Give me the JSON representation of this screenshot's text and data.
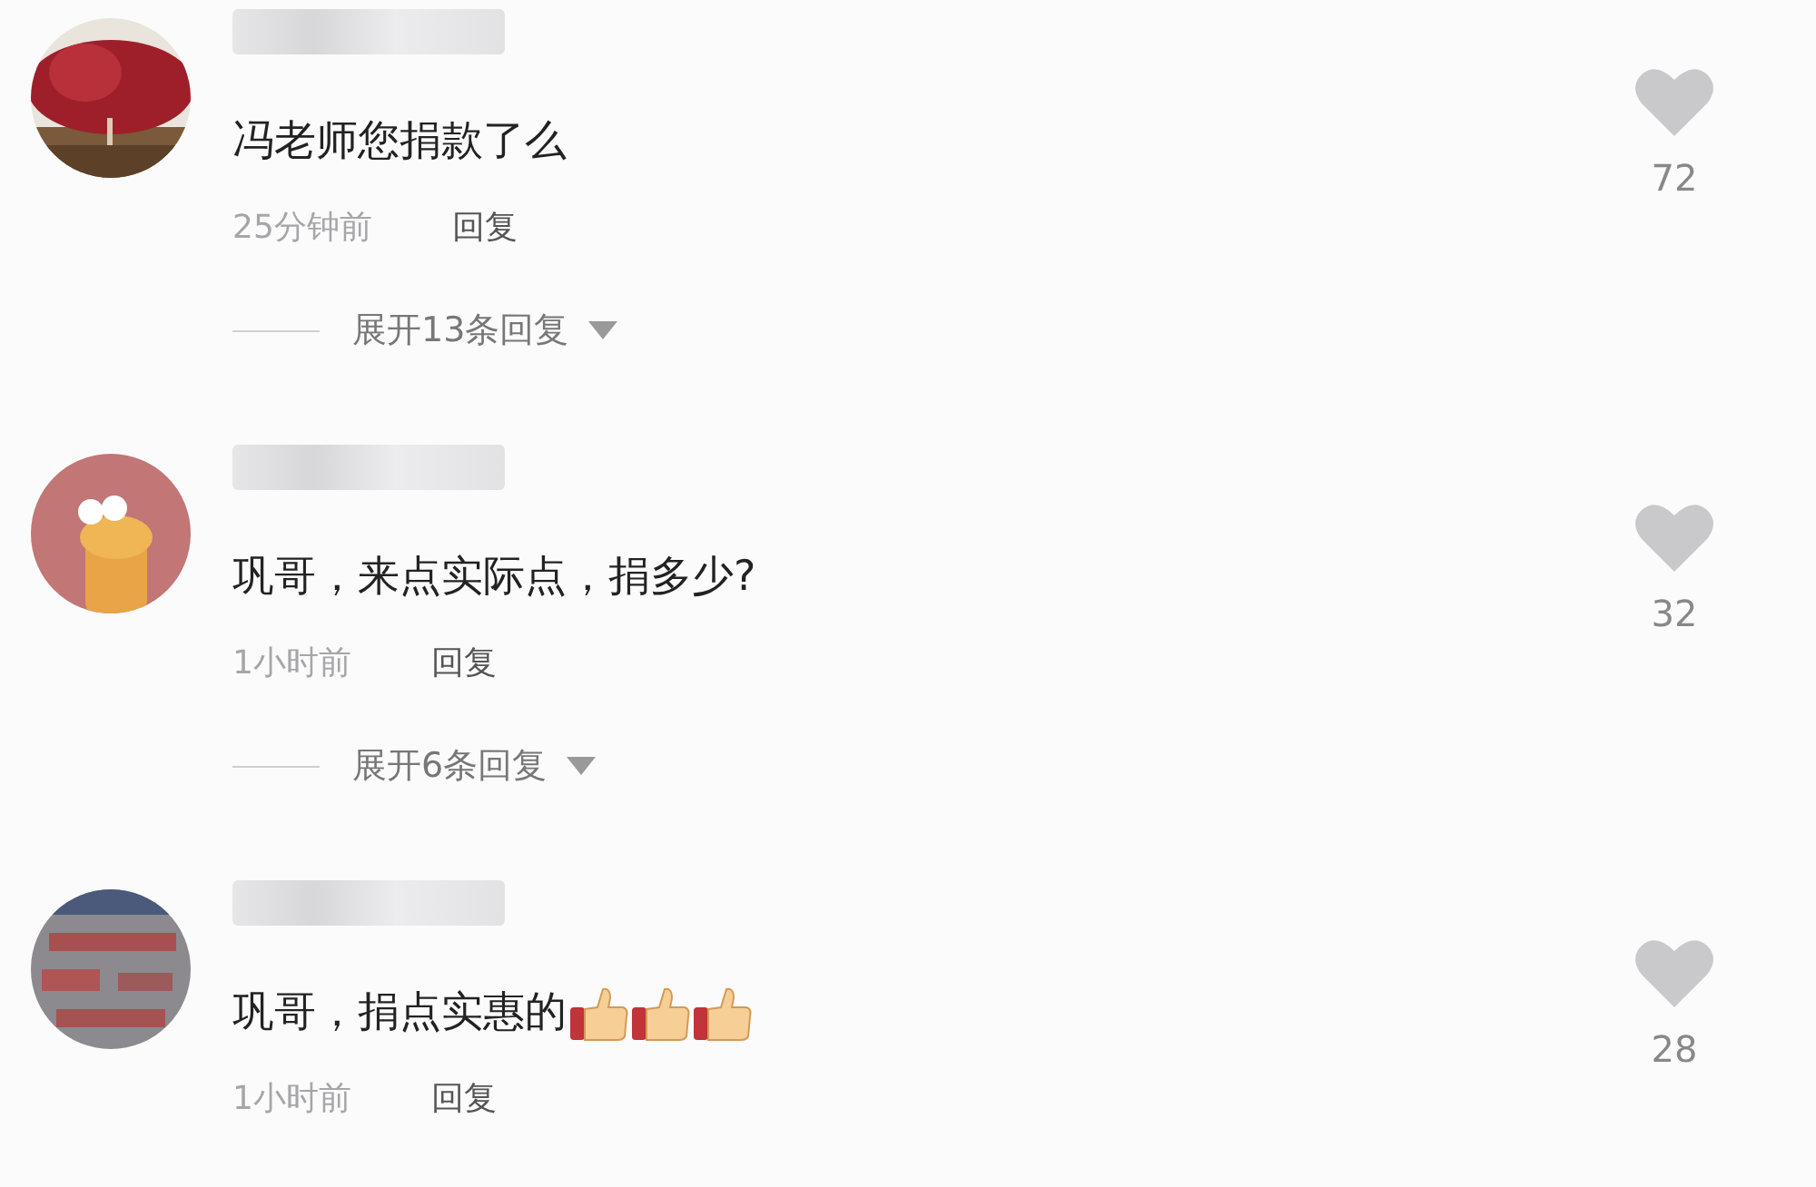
{
  "comments": [
    {
      "text": "冯老师您捐款了么",
      "time": "25分钟前",
      "reply_label": "回复",
      "expand_replies": "展开13条回复",
      "liked": false,
      "likes": "72"
    },
    {
      "text": "巩哥，来点实际点，捐多少?",
      "time": "1小时前",
      "reply_label": "回复",
      "expand_replies": "展开6条回复",
      "liked": false,
      "likes": "32"
    },
    {
      "text": "巩哥，捐点实惠的",
      "emoji": [
        {
          "kind": "thumbs_up"
        },
        {
          "kind": "thumbs_up"
        },
        {
          "kind": "thumbs_up"
        }
      ],
      "time": "1小时前",
      "reply_label": "回复",
      "liked": false,
      "likes": "28"
    }
  ]
}
